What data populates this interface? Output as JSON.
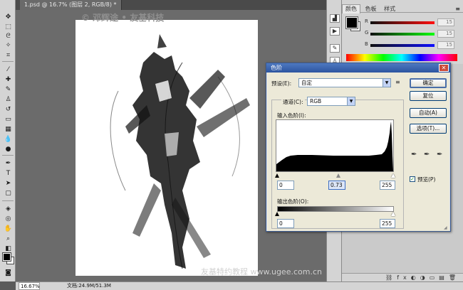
{
  "document": {
    "tab_title": "1.psd @ 16.7% (图层 2, RGB/8) *",
    "watermark_top": "© 邓辉途 • 友基科技",
    "watermark_bottom": "友基特约教程 www.ugee.com.cn"
  },
  "statusbar": {
    "zoom": "16.67%",
    "doc_size": "文档:24.9M/51.3M"
  },
  "color_panel": {
    "tabs": [
      "颜色",
      "色板",
      "样式"
    ],
    "active_tab": "颜色",
    "channels": [
      {
        "label": "R",
        "value": "15",
        "color": "#d03030"
      },
      {
        "label": "G",
        "value": "15",
        "color": "#30a030"
      },
      {
        "label": "B",
        "value": "15",
        "color": "#3040c0"
      }
    ],
    "foreground_color": "#000000",
    "background_color": "#ffffff"
  },
  "levels": {
    "title": "色阶",
    "preset_label": "预设(E):",
    "preset_value": "自定",
    "channel_label": "通道(C):",
    "channel_value": "RGB",
    "input_label": "输入色阶(I):",
    "input_black": "0",
    "input_gamma": "0.73",
    "input_white": "255",
    "output_label": "输出色阶(O):",
    "output_black": "0",
    "output_white": "255",
    "buttons": {
      "ok": "确定",
      "reset": "复位",
      "auto": "自动(A)",
      "options": "选项(T)..."
    },
    "preview_label": "预览(P)",
    "preview_checked": true
  }
}
